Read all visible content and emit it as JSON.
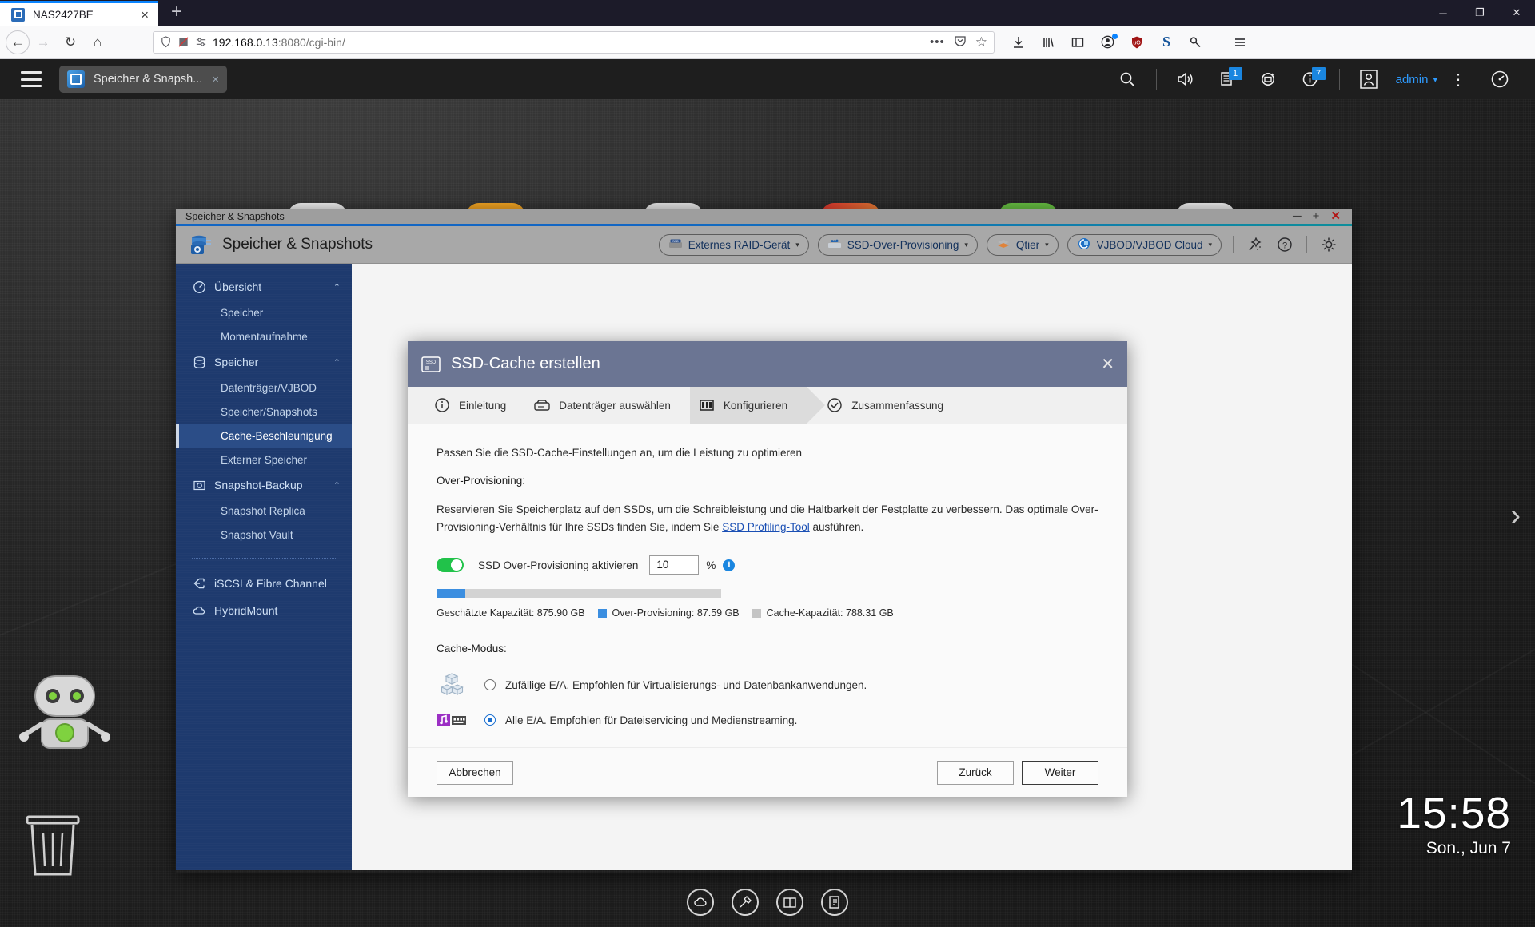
{
  "browser": {
    "tab": {
      "title": "NAS2427BE",
      "favicon": "nas-icon",
      "close": "×"
    },
    "newtab_label": "+",
    "window_controls": {
      "minimize": "─",
      "maximize": "❐",
      "close": "✕"
    },
    "nav": {
      "back": "←",
      "forward": "→",
      "reload": "↻",
      "home": "⌂"
    },
    "url": {
      "host": "192.168.0.13",
      "rest": ":8080/cgi-bin/"
    },
    "urlbar_icons": {
      "shield": "shield-icon",
      "noscript": "noscript-icon",
      "permissions": "permissions-icon",
      "more": "•••",
      "pocket": "pocket-icon",
      "bookmark": "☆"
    },
    "toolbar_icons": [
      "download-icon",
      "library-icon",
      "sidebar-icon",
      "account-icon",
      "ublock-icon",
      "s-extension-icon",
      "key-icon",
      "menu-icon"
    ]
  },
  "qts": {
    "topbar": {
      "menu": "hamburger-icon",
      "open_app": {
        "label": "Speicher & Snapsh...",
        "close": "×"
      },
      "icons": [
        {
          "name": "search-icon",
          "badge": null
        },
        {
          "name": "volume-icon",
          "badge": null
        },
        {
          "name": "background-tasks-icon",
          "badge": "1"
        },
        {
          "name": "external-device-icon",
          "badge": null
        },
        {
          "name": "notifications-icon",
          "badge": "7"
        }
      ],
      "user": {
        "avatar": "user-avatar-icon",
        "name": "admin",
        "caret": "▾"
      },
      "more": "⋮",
      "dashboard": "dashboard-icon"
    },
    "clock": {
      "time": "15:58",
      "date": "Son., Jun 7"
    },
    "page_dots": [
      true,
      false,
      false
    ],
    "taskbar_icons": [
      "cloud-icon",
      "helpdesk-icon",
      "window-icon",
      "notes-icon"
    ],
    "side_arrow": "›"
  },
  "app": {
    "titlebar": {
      "title": "Speicher & Snapshots",
      "minimize": "─",
      "maximize": "+",
      "close": "✕"
    },
    "header_title": "Speicher & Snapshots",
    "toolbar_buttons": [
      {
        "label": "Externes RAID-Gerät",
        "icon": "raid-device-icon",
        "caret": "▾"
      },
      {
        "label": "SSD-Over-Provisioning",
        "icon": "ssd-op-icon",
        "caret": "▾"
      },
      {
        "label": "Qtier",
        "icon": "qtier-icon",
        "caret": "▾"
      },
      {
        "label": "VJBOD/VJBOD Cloud",
        "icon": "vjbod-icon",
        "caret": "▾"
      }
    ],
    "toolbar_icons": [
      {
        "name": "magic-wand-icon"
      },
      {
        "name": "help-icon"
      },
      {
        "name": "settings-gear-icon"
      }
    ],
    "sidebar": [
      {
        "type": "group",
        "label": "Übersicht",
        "icon": "gauge-icon",
        "chevron": "⌃"
      },
      {
        "type": "item",
        "label": "Speicher",
        "active": false
      },
      {
        "type": "item",
        "label": "Momentaufnahme",
        "active": false
      },
      {
        "type": "group",
        "label": "Speicher",
        "icon": "database-icon",
        "chevron": "⌃"
      },
      {
        "type": "item",
        "label": "Datenträger/VJBOD",
        "active": false
      },
      {
        "type": "item",
        "label": "Speicher/Snapshots",
        "active": false
      },
      {
        "type": "item",
        "label": "Cache-Beschleunigung",
        "active": true
      },
      {
        "type": "item",
        "label": "Externer Speicher",
        "active": false
      },
      {
        "type": "group",
        "label": "Snapshot-Backup",
        "icon": "snapshot-icon",
        "chevron": "⌃"
      },
      {
        "type": "item",
        "label": "Snapshot Replica",
        "active": false
      },
      {
        "type": "item",
        "label": "Snapshot Vault",
        "active": false
      },
      {
        "type": "divider"
      },
      {
        "type": "group",
        "label": "iSCSI & Fibre Channel",
        "icon": "iscsi-icon",
        "chevron": ""
      },
      {
        "type": "group",
        "label": "HybridMount",
        "icon": "hybridmount-icon",
        "chevron": ""
      }
    ]
  },
  "modal": {
    "title": "SSD-Cache erstellen",
    "icon": "ssd-icon",
    "close": "✕",
    "steps": [
      {
        "label": "Einleitung",
        "icon": "info-circle-icon",
        "current": false
      },
      {
        "label": "Datenträger auswählen",
        "icon": "disk-icon",
        "current": false
      },
      {
        "label": "Konfigurieren",
        "icon": "configure-icon",
        "current": true
      },
      {
        "label": "Zusammenfassung",
        "icon": "check-circle-icon",
        "current": false
      }
    ],
    "intro": "Passen Sie die SSD-Cache-Einstellungen an, um die Leistung zu optimieren",
    "section_overprovisioning": "Over-Provisioning:",
    "description_part1": "Reservieren Sie Speicherplatz auf den SSDs, um die Schreibleistung und die Haltbarkeit der Festplatte zu verbessern. Das optimale Over-Provisioning-Verhältnis für Ihre SSDs finden Sie, indem Sie ",
    "description_link": "SSD Profiling-Tool",
    "description_part2": " ausführen.",
    "toggle_label": "SSD Over-Provisioning aktivieren",
    "toggle_on": true,
    "percent_value": "10",
    "percent_sign": "%",
    "info_glyph": "i",
    "capacity": {
      "fill_percent": 10,
      "estimated_label": "Geschätzte Kapazität: 875.90 GB",
      "overprovisioning_label": "Over-Provisioning: 87.59 GB",
      "cache_label": "Cache-Kapazität: 788.31 GB",
      "color_overprovisioning": "#3b8ee0",
      "color_cache": "#c4c4c4"
    },
    "section_cache_mode": "Cache-Modus:",
    "modes": [
      {
        "label": "Zufällige E/A. Empfohlen für Virtualisierungs- und Datenbankanwendungen.",
        "icon": "cubes-icon",
        "selected": false
      },
      {
        "label": "Alle E/A. Empfohlen für Dateiservicing und Medienstreaming.",
        "icon": "media-icon",
        "selected": true
      }
    ],
    "buttons": {
      "cancel": "Abbrechen",
      "back": "Zurück",
      "next": "Weiter"
    }
  }
}
